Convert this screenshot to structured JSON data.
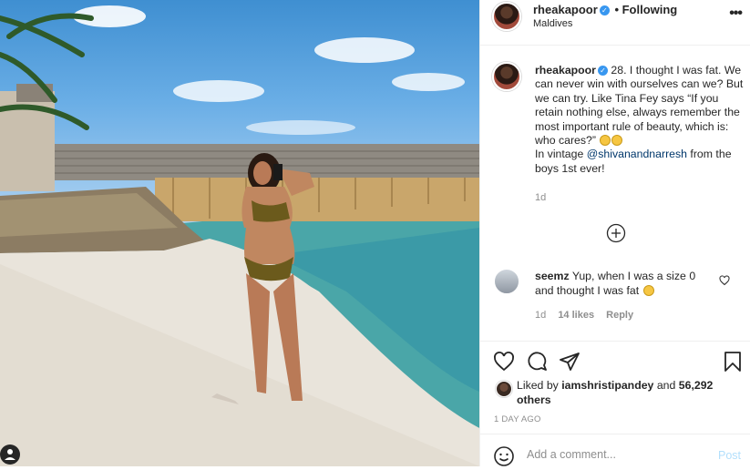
{
  "header": {
    "username": "rheakapoor",
    "following_label": "• Following",
    "location": "Maldives",
    "more_label": "•••"
  },
  "caption": {
    "username": "rheakapoor",
    "text_before_mention": "28. I thought I was fat. We can never win with ourselves can we? But we can try. Like Tina Fey says “If you retain nothing else, always remember the most important rule of beauty, which is: who cares?”",
    "text_vintage": "In vintage",
    "mention": "@shivanandnarresh",
    "text_after_mention": "from the boys 1st ever!",
    "time": "1d"
  },
  "comment": {
    "username": "seemz",
    "text": "Yup, when I was a size 0 and thought I was fat",
    "time": "1d",
    "likes": "14 likes",
    "reply_label": "Reply"
  },
  "liked_by": {
    "prefix": "Liked by",
    "user": "iamshristipandey",
    "and_label": "and",
    "others": "56,292 others"
  },
  "timestamp": "1 DAY AGO",
  "add_comment": {
    "placeholder": "Add a comment...",
    "post_label": "Post"
  },
  "colors": {
    "verified": "#3897f0",
    "link": "#00376b",
    "post_button": "#b2dffc"
  },
  "icons": [
    "heart-icon",
    "comment-icon",
    "share-icon",
    "bookmark-icon",
    "smiley-icon",
    "load-more-icon",
    "user-tag-icon",
    "verified-icon"
  ]
}
